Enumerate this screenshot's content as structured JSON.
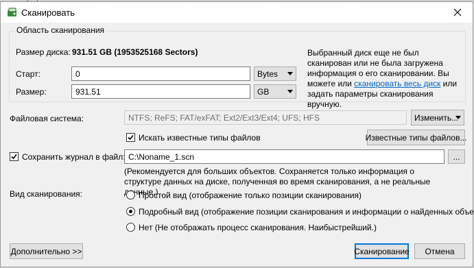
{
  "background_tabs": [
    "...(...) ...",
    "...",
    "...",
    "...",
    "..."
  ],
  "window": {
    "title": "Сканировать"
  },
  "scan_area": {
    "group_label": "Область сканирования",
    "disk_size_label": "Размер диска:",
    "disk_size_value": "931.51 GB (1953525168 Sectors)",
    "start_label": "Старт:",
    "start_value": "0",
    "start_unit": "Bytes",
    "size_label": "Размер:",
    "size_value": "931.51",
    "size_unit": "GB",
    "info_before": "Выбранный диск еще не был сканирован или не была загружена информация о его сканировании. Вы можете или",
    "info_link": "сканировать весь диск",
    "info_after": "или задать параметры сканирования вручную."
  },
  "filesystem": {
    "label": "Файловая система:",
    "value": "NTFS; ReFS; FAT/exFAT; Ext2/Ext3/Ext4; UFS; HFS",
    "change_button": "Изменить..."
  },
  "known_types": {
    "checkbox_label": "Искать известные типы файлов",
    "checked": true,
    "button": "Известные типы файлов..."
  },
  "log": {
    "checkbox_label": "Сохранить журнал в файл:",
    "checked": true,
    "path": "C:\\Noname_1.scn",
    "browse_button": "...",
    "hint": "(Рекомендуется для больших объектов. Сохраняется только информация о структуре данных на диске, полученная во время сканирования, а не реальные данные.)"
  },
  "view": {
    "label": "Вид сканирования:",
    "options": [
      "Простой вид (отображение только позиции сканирования)",
      "Подробный вид (отображение позиции сканирования и информации о найденных объектах)",
      "Нет (Не отображать процесс сканирования. Наибыстрейший.)"
    ],
    "selected_index": 1
  },
  "buttons": {
    "advanced": "Дополнительно >>",
    "scan": "Сканирование",
    "cancel": "Отмена"
  },
  "colors": {
    "accent": "#0078d7",
    "link": "#0066cc"
  }
}
